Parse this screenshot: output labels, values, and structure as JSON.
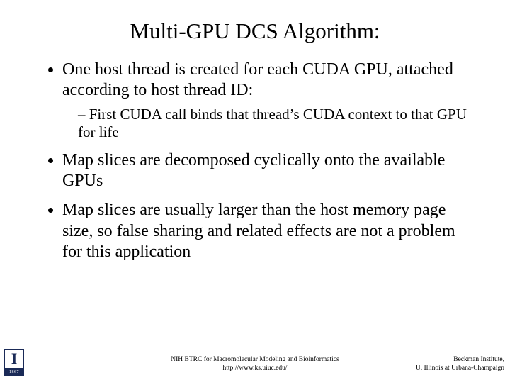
{
  "title": "Multi-GPU DCS Algorithm:",
  "bullets": [
    {
      "text": "One host thread is created for each CUDA GPU, attached according to host thread ID:",
      "sub": [
        "First CUDA call binds that thread’s CUDA context to that GPU for life"
      ]
    },
    {
      "text": "Map slices are decomposed cyclically onto the available GPUs",
      "sub": []
    },
    {
      "text": "Map slices are usually larger than the host memory page size, so false sharing and related effects are not a problem for this application",
      "sub": []
    }
  ],
  "logo": {
    "letter": "I",
    "year": "1867"
  },
  "footer": {
    "center_line1": "NIH BTRC for Macromolecular Modeling and Bioinformatics",
    "center_line2": "http://www.ks.uiuc.edu/",
    "right_line1": "Beckman Institute,",
    "right_line2": "U. Illinois at Urbana-Champaign"
  }
}
